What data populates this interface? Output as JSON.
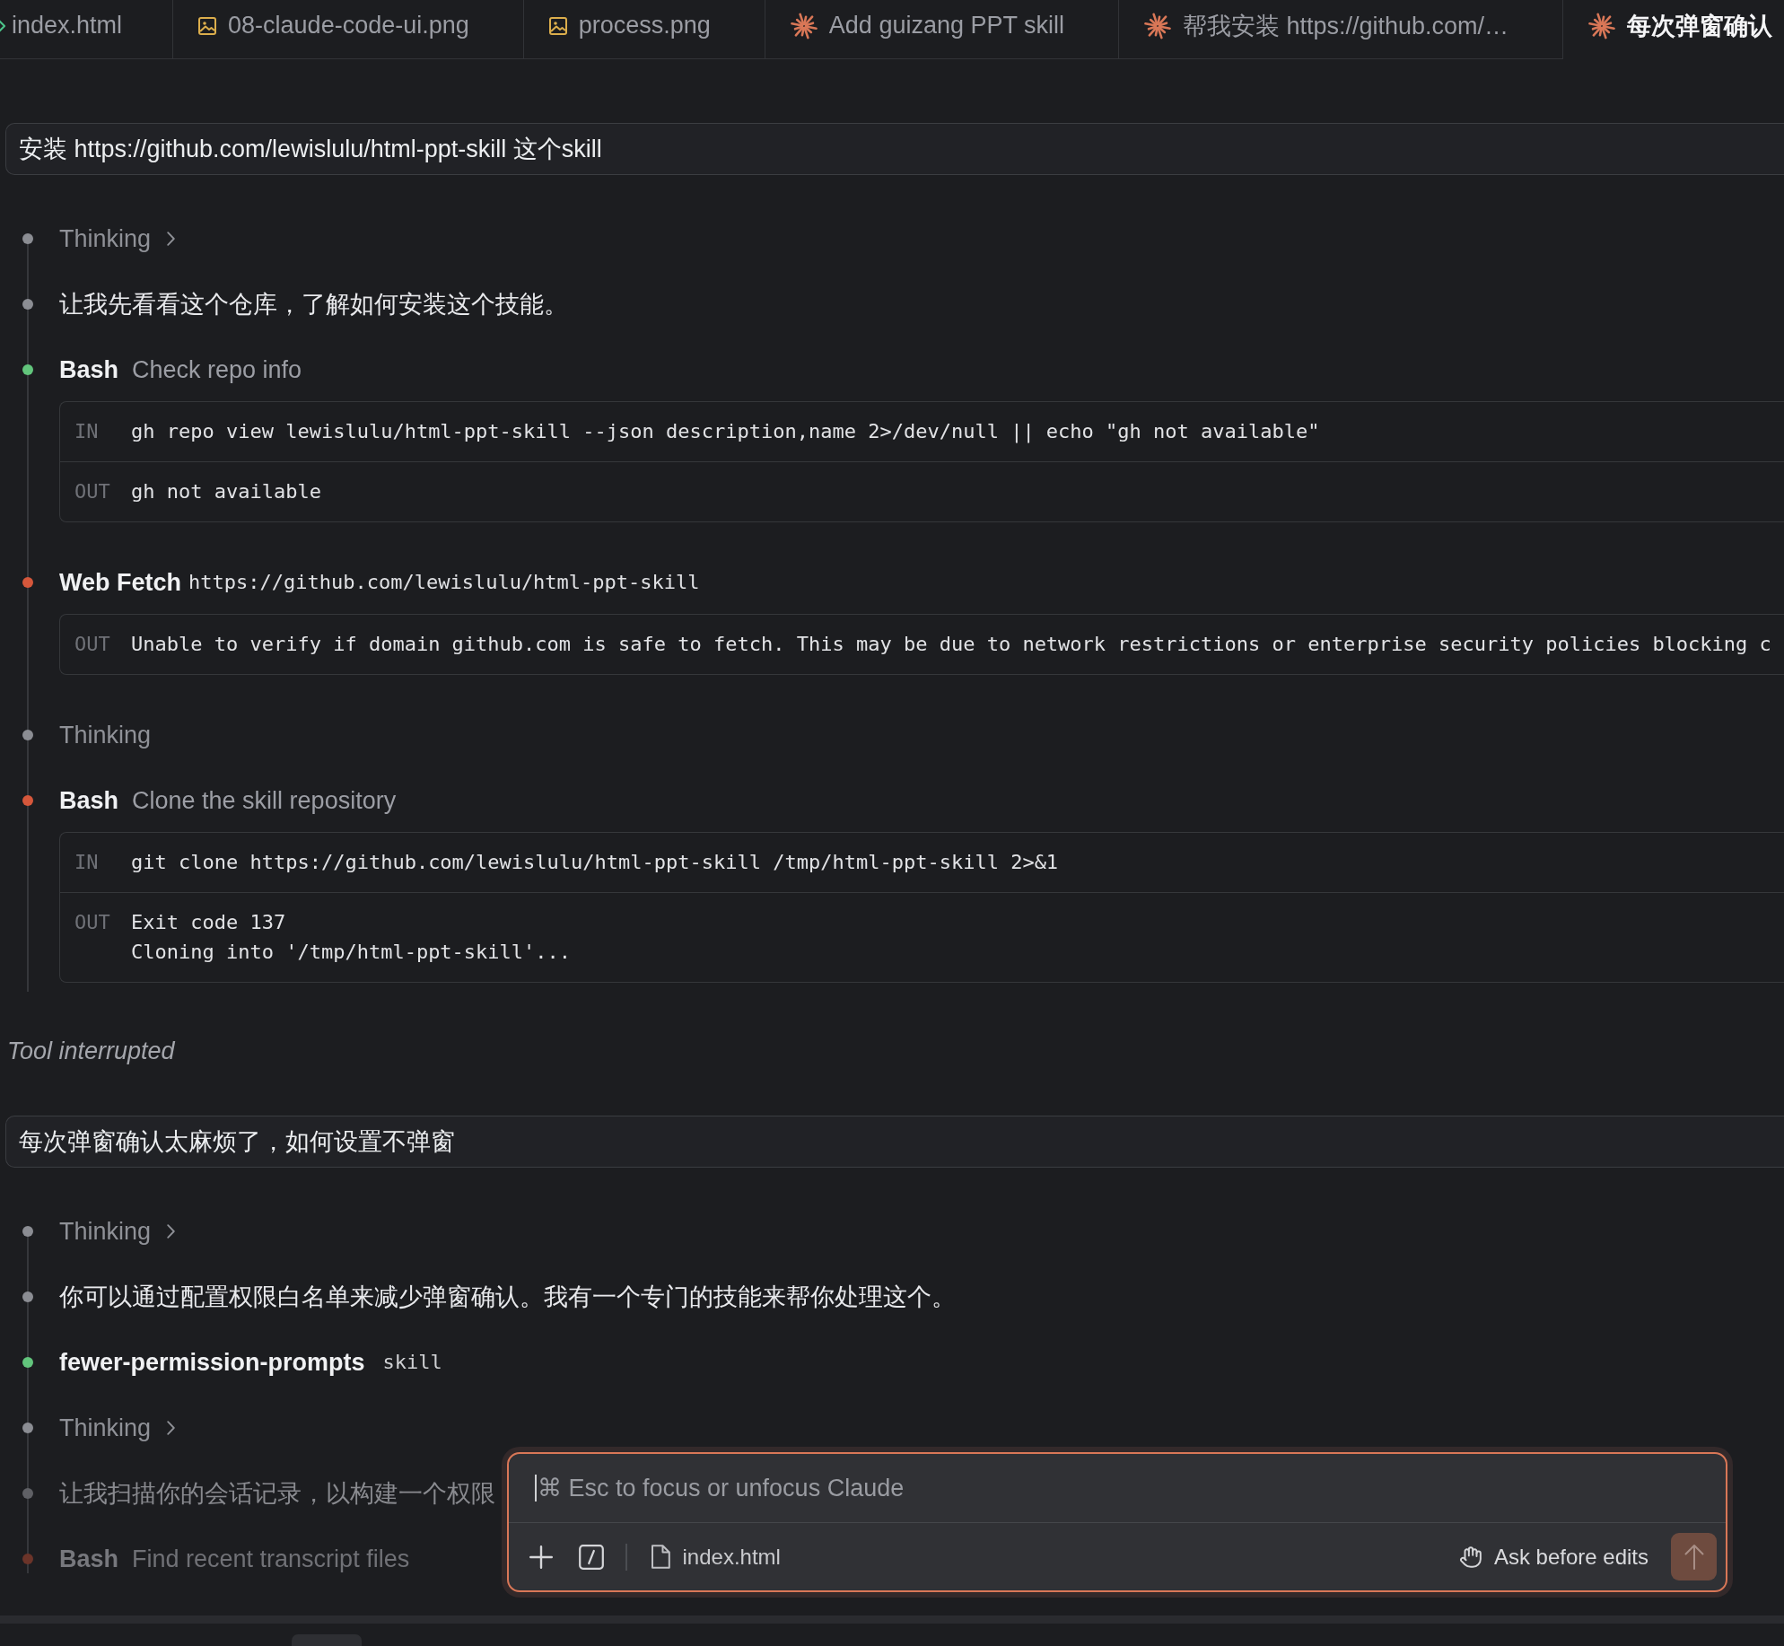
{
  "tabs": [
    {
      "label": "index.html",
      "kind": "code",
      "selected": false
    },
    {
      "label": "08-claude-code-ui.png",
      "kind": "image",
      "selected": false
    },
    {
      "label": "process.png",
      "kind": "image",
      "selected": false
    },
    {
      "label": "Add guizang PPT skill",
      "kind": "chat",
      "selected": false
    },
    {
      "label": "帮我安装 https://github.com/…",
      "kind": "chat",
      "selected": false
    },
    {
      "label": "每次弹窗确认",
      "kind": "chat",
      "selected": true
    }
  ],
  "conversation": [
    {
      "kind": "user",
      "text": "安装 https://github.com/lewislulu/html-ppt-skill 这个skill"
    },
    {
      "kind": "steps",
      "steps": [
        {
          "kind": "thinking",
          "text": "Thinking",
          "expandable": true,
          "dimmed": false
        },
        {
          "kind": "text",
          "text": "让我先看看这个仓库，了解如何安装这个技能。",
          "dimmed": false
        },
        {
          "kind": "tool",
          "name": "Bash",
          "summary": "Check repo info",
          "color": "#62c57c",
          "dimmed": false,
          "io": [
            {
              "label": "IN",
              "lines": [
                "gh repo view lewislulu/html-ppt-skill --json description,name 2>/dev/null || echo \"gh not available\""
              ]
            },
            {
              "label": "OUT",
              "lines": [
                "gh not available"
              ]
            }
          ]
        },
        {
          "kind": "fetch",
          "name": "Web Fetch",
          "summary": "https://github.com/lewislulu/html-ppt-skill",
          "color": "#d5573b",
          "dimmed": false,
          "io": [
            {
              "label": "OUT",
              "lines": [
                "Unable to verify if domain github.com is safe to fetch. This may be due to network restrictions or enterprise security policies blocking c"
              ]
            }
          ]
        },
        {
          "kind": "thinking",
          "text": "Thinking",
          "expandable": false,
          "dimmed": false
        },
        {
          "kind": "tool",
          "name": "Bash",
          "summary": "Clone the skill repository",
          "color": "#d5573b",
          "dimmed": false,
          "io": [
            {
              "label": "IN",
              "lines": [
                "git clone https://github.com/lewislulu/html-ppt-skill /tmp/html-ppt-skill 2>&1"
              ]
            },
            {
              "label": "OUT",
              "lines": [
                "Exit code 137",
                "Cloning into '/tmp/html-ppt-skill'..."
              ]
            }
          ]
        }
      ]
    },
    {
      "kind": "notice",
      "text": "Tool interrupted"
    },
    {
      "kind": "user",
      "text": "每次弹窗确认太麻烦了，如何设置不弹窗"
    },
    {
      "kind": "steps",
      "steps": [
        {
          "kind": "thinking",
          "text": "Thinking",
          "expandable": true,
          "dimmed": false
        },
        {
          "kind": "text",
          "text": "你可以通过配置权限白名单来减少弹窗确认。我有一个专门的技能来帮你处理这个。",
          "dimmed": false
        },
        {
          "kind": "skill",
          "name": "fewer-permission-prompts",
          "summary": "skill",
          "color": "#62c57c",
          "dimmed": false
        },
        {
          "kind": "thinking",
          "text": "Thinking",
          "expandable": true,
          "dimmed": false
        },
        {
          "kind": "text",
          "text": "让我扫描你的会话记录，以构建一个权限",
          "dimmed": true
        },
        {
          "kind": "tool",
          "name": "Bash",
          "summary": "Find recent transcript files",
          "color": "#6b3429",
          "dimmed": true
        }
      ]
    }
  ],
  "composer": {
    "focused": true,
    "placeholder": "⌘ Esc to focus or unfocus Claude",
    "attachment": "index.html",
    "mode": "Ask before edits",
    "send": {
      "disabled": true
    }
  }
}
